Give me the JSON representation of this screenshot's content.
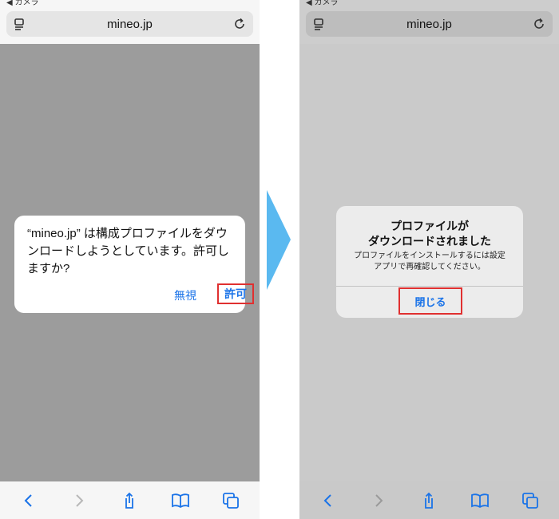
{
  "left_screen": {
    "status_back": "◀ カメラ",
    "url": "mineo.jp",
    "dialog": {
      "message": "“mineo.jp” は構成プロファイルをダウンロードしようとしています。許可しますか?",
      "ignore_label": "無視",
      "allow_label": "許可"
    }
  },
  "right_screen": {
    "status_back": "◀ カメラ",
    "url": "mineo.jp",
    "dialog": {
      "title_line1": "プロファイルが",
      "title_line2": "ダウンロードされました",
      "sub_line1": "プロファイルをインストールするには設定",
      "sub_line2": "アプリで再確認してください。",
      "close_label": "閉じる"
    }
  },
  "colors": {
    "accent_blue": "#1a73e8",
    "highlight_red": "#e03030",
    "arrow_blue": "#5ab9f0"
  },
  "icons": [
    "reader-icon",
    "reload-icon",
    "back-icon",
    "forward-icon",
    "share-icon",
    "bookmarks-icon",
    "tabs-icon"
  ]
}
